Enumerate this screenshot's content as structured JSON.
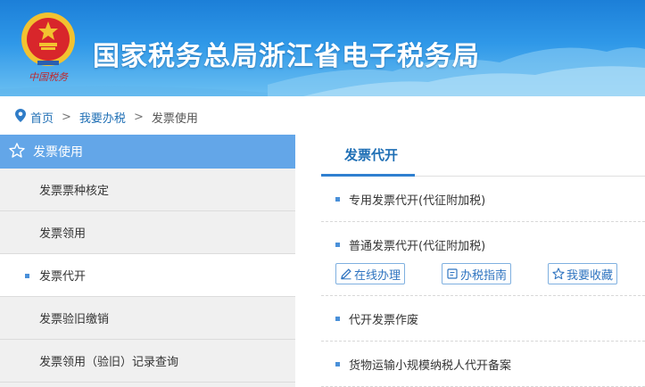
{
  "header": {
    "title": "国家税务总局浙江省电子税务局",
    "emblem_caption": "中国税务"
  },
  "breadcrumb": {
    "home": "首页",
    "level2": "我要办税",
    "current": "发票使用",
    "separator": ">"
  },
  "sidebar": {
    "header_label": "发票使用",
    "items": [
      {
        "label": "发票票种核定",
        "active": false
      },
      {
        "label": "发票领用",
        "active": false
      },
      {
        "label": "发票代开",
        "active": true
      },
      {
        "label": "发票验旧缴销",
        "active": false
      },
      {
        "label": "发票领用（验旧）记录查询",
        "active": false
      }
    ]
  },
  "main": {
    "tab_label": "发票代开",
    "services": [
      {
        "label": "专用发票代开(代征附加税)"
      },
      {
        "label": "普通发票代开(代征附加税)"
      },
      {
        "label": "代开发票作废"
      },
      {
        "label": "货物运输小规模纳税人代开备案"
      }
    ],
    "actions": {
      "online": "在线办理",
      "guide": "办税指南",
      "favorite": "我要收藏"
    }
  },
  "colors": {
    "accent": "#2f80d0",
    "sidebar_header": "#63a6e8",
    "link": "#1f6fb5"
  }
}
